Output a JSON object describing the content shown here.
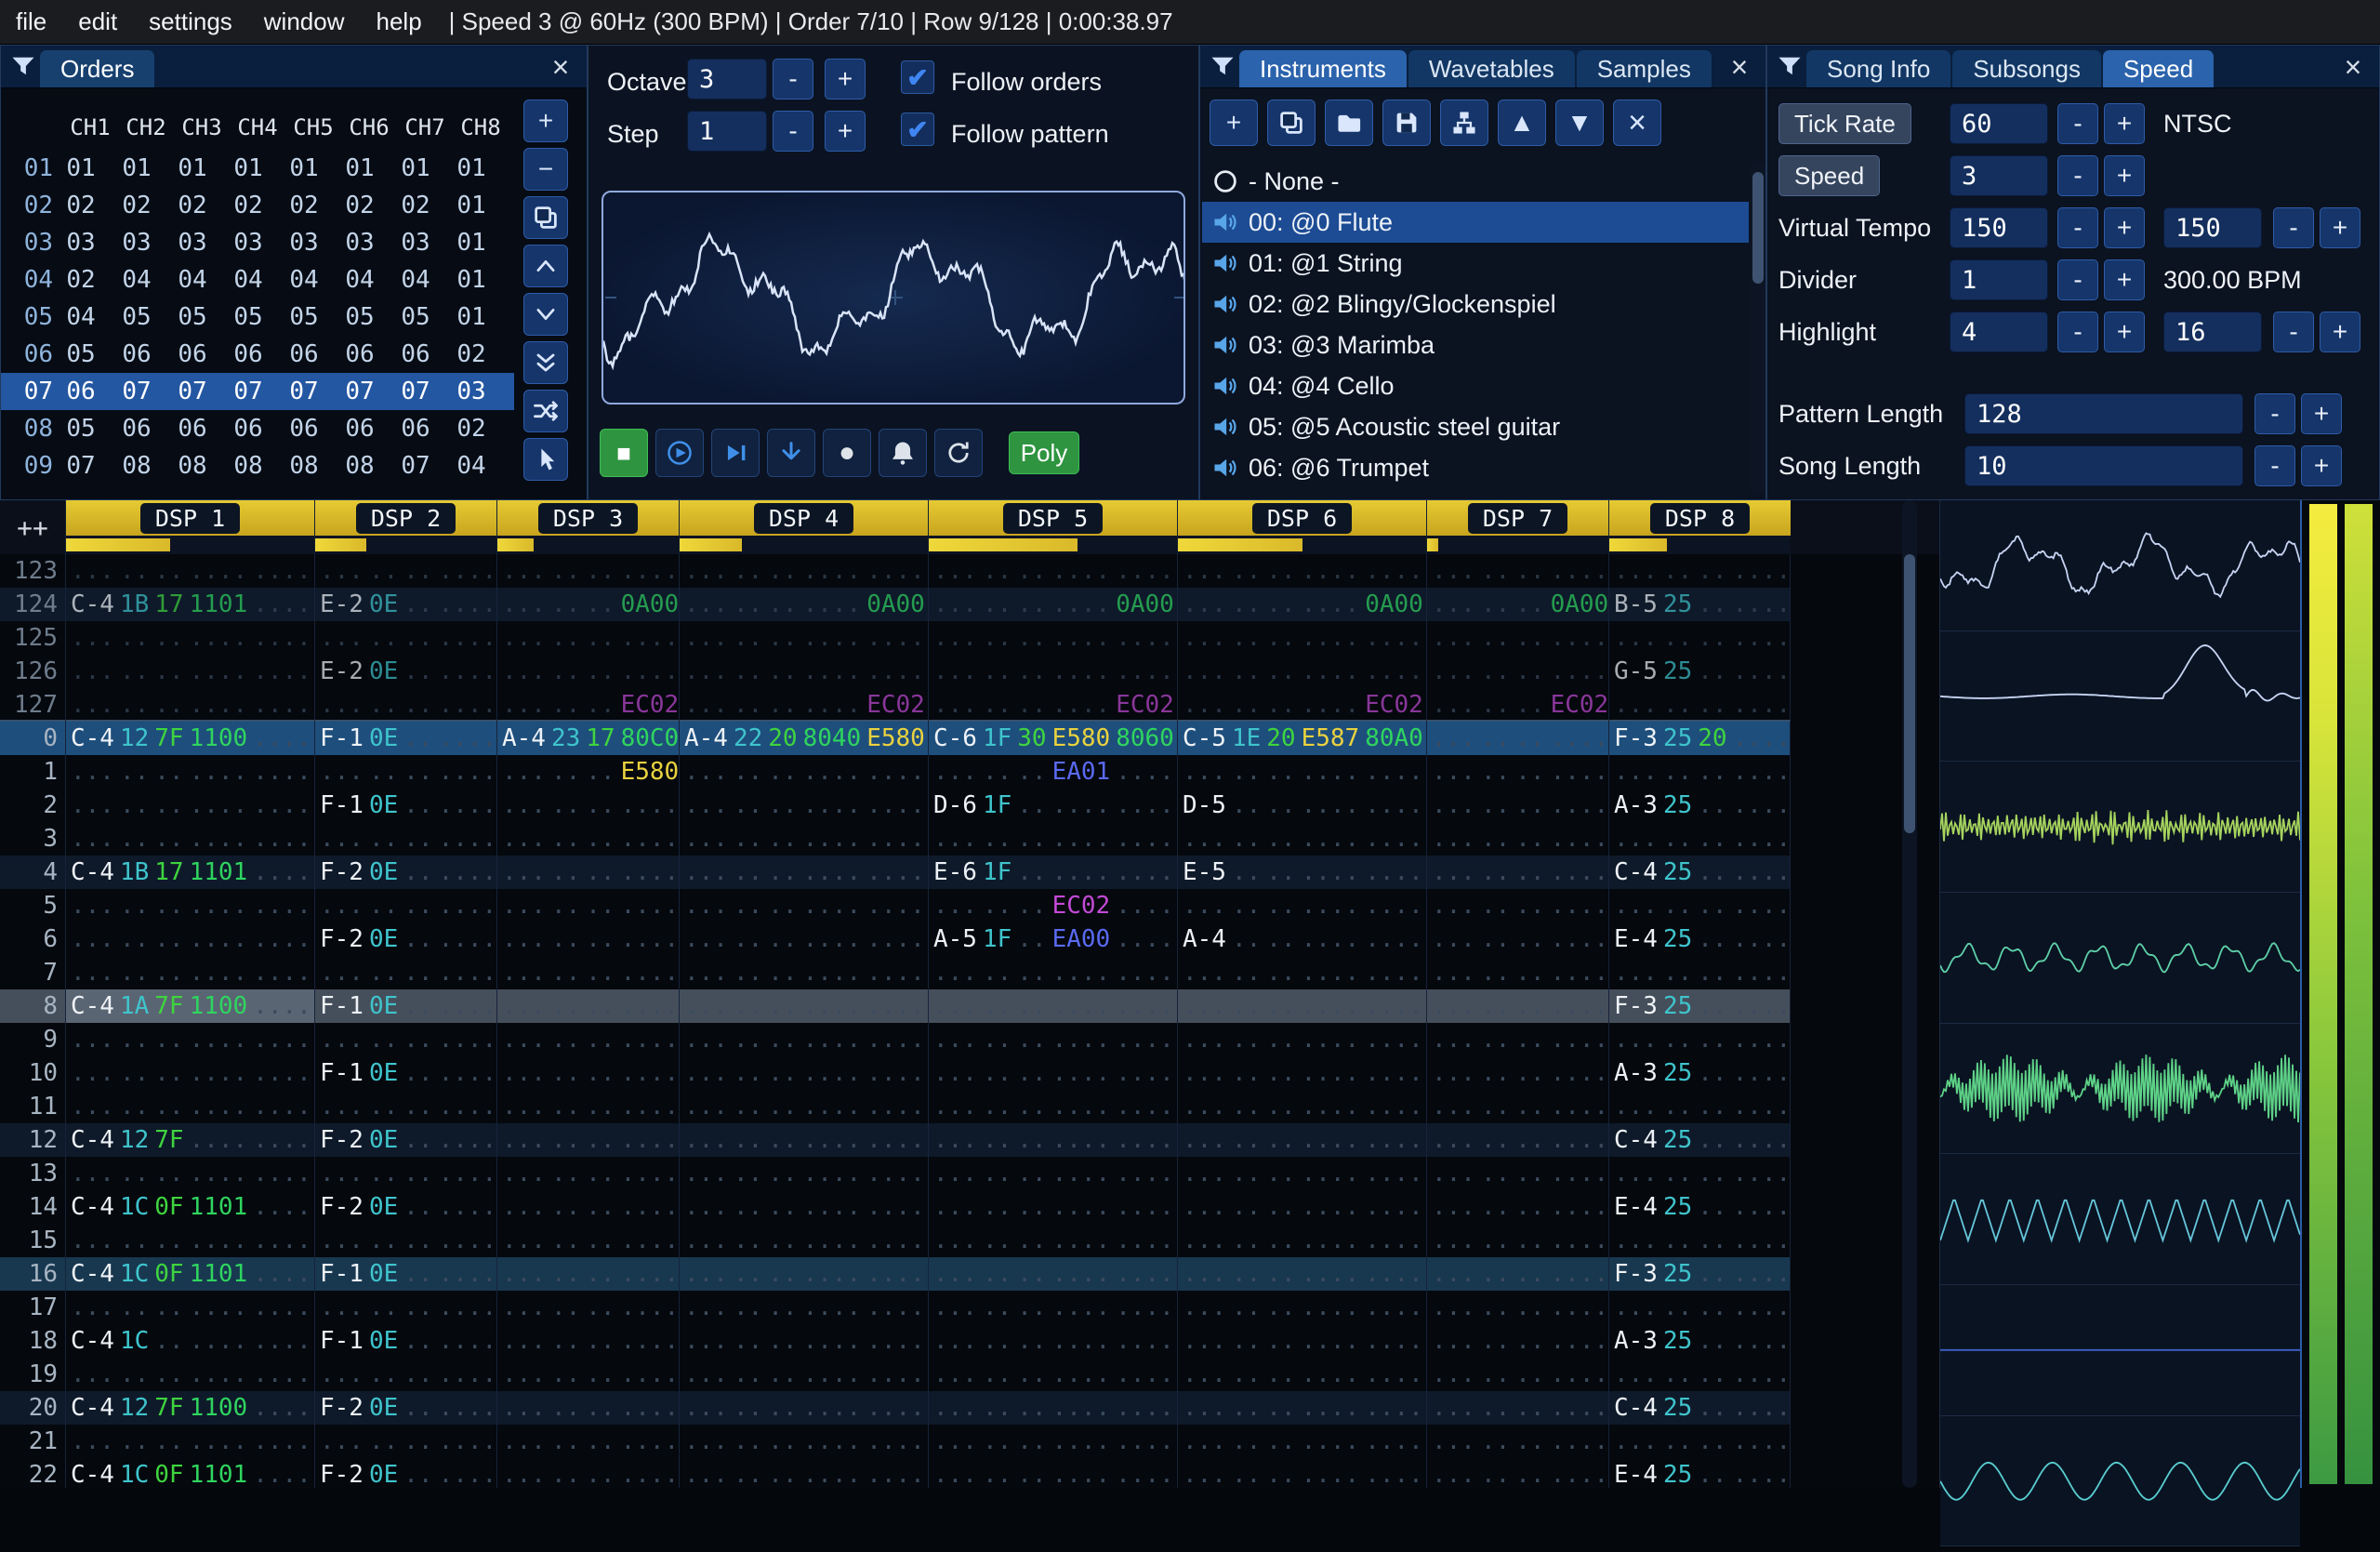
{
  "menu": {
    "items": [
      "file",
      "edit",
      "settings",
      "window",
      "help"
    ],
    "status": "| Speed 3 @ 60Hz (300 BPM) | Order 7/10 | Row 9/128 | 0:00:38.97"
  },
  "orders": {
    "title": "Orders",
    "close_label": "×",
    "columns": [
      "CH1",
      "CH2",
      "CH3",
      "CH4",
      "CH5",
      "CH6",
      "CH7",
      "CH8"
    ],
    "rows": [
      {
        "n": "01",
        "v": [
          "01",
          "01",
          "01",
          "01",
          "01",
          "01",
          "01",
          "01"
        ],
        "selected": false
      },
      {
        "n": "02",
        "v": [
          "02",
          "02",
          "02",
          "02",
          "02",
          "02",
          "02",
          "01"
        ],
        "selected": false
      },
      {
        "n": "03",
        "v": [
          "03",
          "03",
          "03",
          "03",
          "03",
          "03",
          "03",
          "01"
        ],
        "selected": false
      },
      {
        "n": "04",
        "v": [
          "02",
          "04",
          "04",
          "04",
          "04",
          "04",
          "04",
          "01"
        ],
        "selected": false
      },
      {
        "n": "05",
        "v": [
          "04",
          "05",
          "05",
          "05",
          "05",
          "05",
          "05",
          "01"
        ],
        "selected": false
      },
      {
        "n": "06",
        "v": [
          "05",
          "06",
          "06",
          "06",
          "06",
          "06",
          "06",
          "02"
        ],
        "selected": false
      },
      {
        "n": "07",
        "v": [
          "06",
          "07",
          "07",
          "07",
          "07",
          "07",
          "07",
          "03"
        ],
        "selected": true
      },
      {
        "n": "08",
        "v": [
          "05",
          "06",
          "06",
          "06",
          "06",
          "06",
          "06",
          "02"
        ],
        "selected": false
      },
      {
        "n": "09",
        "v": [
          "07",
          "08",
          "08",
          "08",
          "08",
          "08",
          "07",
          "04"
        ],
        "selected": false
      }
    ],
    "buttons": [
      {
        "icon": "plus",
        "name": "order-add-button"
      },
      {
        "icon": "minus",
        "name": "order-remove-button"
      },
      {
        "icon": "clone",
        "name": "order-duplicate-button"
      },
      {
        "icon": "chevron-up",
        "name": "order-move-up-button"
      },
      {
        "icon": "chevron-down",
        "name": "order-move-down-button"
      },
      {
        "icon": "chevron-double-down",
        "name": "order-duplicate-to-end-button"
      },
      {
        "icon": "shuffle",
        "name": "order-change-mode-button"
      },
      {
        "icon": "pointer",
        "name": "order-edit-mode-button"
      }
    ]
  },
  "controls": {
    "octave_label": "Octave",
    "octave_value": "3",
    "step_label": "Step",
    "step_value": "1",
    "minus_label": "-",
    "plus_label": "+",
    "follow_orders_label": "Follow orders",
    "follow_orders_checked": true,
    "follow_pattern_label": "Follow pattern",
    "follow_pattern_checked": true,
    "transport": [
      {
        "icon": "stop",
        "name": "stop-button",
        "style": "green"
      },
      {
        "icon": "play",
        "name": "play-button"
      },
      {
        "icon": "play-pattern",
        "name": "play-from-pattern-button"
      },
      {
        "icon": "step-down",
        "name": "step-one-row-button"
      },
      {
        "icon": "record",
        "name": "record-button"
      },
      {
        "icon": "bell",
        "name": "metronome-button"
      },
      {
        "icon": "repeat",
        "name": "repeat-pattern-button"
      }
    ],
    "poly_label": "Poly"
  },
  "instruments": {
    "tabs": [
      {
        "label": "Instruments",
        "active": true
      },
      {
        "label": "Wavetables",
        "active": false
      },
      {
        "label": "Samples",
        "active": false
      }
    ],
    "close_label": "×",
    "toolbar": [
      {
        "icon": "plus",
        "name": "instrument-add-button"
      },
      {
        "icon": "clone",
        "name": "instrument-clone-button"
      },
      {
        "icon": "folder-open",
        "name": "instrument-open-button"
      },
      {
        "icon": "floppy",
        "name": "instrument-save-button"
      },
      {
        "icon": "dir-tree",
        "name": "instrument-folders-button"
      },
      {
        "icon": "triangle-up",
        "name": "instrument-move-up-button"
      },
      {
        "icon": "triangle-down",
        "name": "instrument-move-down-button"
      },
      {
        "icon": "delete-x",
        "name": "instrument-delete-button"
      }
    ],
    "items": [
      {
        "icon": "none-circle",
        "label": "- None -",
        "selected": false
      },
      {
        "icon": "speaker",
        "label": "00: @0 Flute",
        "selected": true
      },
      {
        "icon": "speaker",
        "label": "01: @1 String",
        "selected": false
      },
      {
        "icon": "speaker",
        "label": "02: @2 Blingy/Glockenspiel",
        "selected": false
      },
      {
        "icon": "speaker",
        "label": "03: @3 Marimba",
        "selected": false
      },
      {
        "icon": "speaker",
        "label": "04: @4 Cello",
        "selected": false
      },
      {
        "icon": "speaker",
        "label": "05: @5 Acoustic steel guitar",
        "selected": false
      },
      {
        "icon": "speaker",
        "label": "06: @6 Trumpet",
        "selected": false
      }
    ]
  },
  "song": {
    "tabs": [
      {
        "label": "Song Info",
        "active": false
      },
      {
        "label": "Subsongs",
        "active": false
      },
      {
        "label": "Speed",
        "active": true
      }
    ],
    "close_label": "×",
    "tick_rate_label": "Tick Rate",
    "tick_rate_value": "60",
    "tick_rate_mode": "NTSC",
    "speed_label": "Speed",
    "speed_value": "3",
    "virtual_tempo_label": "Virtual Tempo",
    "virtual_tempo_value": "150",
    "virtual_tempo_divisor": "150",
    "divider_label": "Divider",
    "divider_value": "1",
    "bpm_text": "300.00 BPM",
    "highlight_label": "Highlight",
    "highlight_first": "4",
    "highlight_second": "16",
    "pattern_length_label": "Pattern Length",
    "pattern_length_value": "128",
    "song_length_label": "Song Length",
    "song_length_value": "10",
    "minus_label": "-",
    "plus_label": "+"
  },
  "pattern": {
    "corner_label": "++",
    "channels": [
      {
        "name": "DSP 1",
        "fx": 2,
        "vu": 0.42
      },
      {
        "name": "DSP 2",
        "fx": 1,
        "vu": 0.28
      },
      {
        "name": "DSP 3",
        "fx": 1,
        "vu": 0.2
      },
      {
        "name": "DSP 4",
        "fx": 2,
        "vu": 0.25
      },
      {
        "name": "DSP 5",
        "fx": 2,
        "vu": 0.6
      },
      {
        "name": "DSP 6",
        "fx": 2,
        "vu": 0.5
      },
      {
        "name": "DSP 7",
        "fx": 1,
        "vu": 0.06
      },
      {
        "name": "DSP 8",
        "fx": 1,
        "vu": 0.32
      }
    ],
    "rows": [
      {
        "n": "123",
        "prev": true,
        "cells": [
          "",
          "",
          "",
          "",
          "",
          "",
          "",
          ""
        ]
      },
      {
        "n": "124",
        "prev": true,
        "hl": "hl4",
        "cells": [
          "C-4 1B 17 1101 ....",
          "E-2 0E .. ....",
          "... .. .. 0A00",
          "... .. .. .... 0A00",
          "... .. .. .... 0A00",
          "... .. .. .... 0A00",
          "... .. .. 0A00",
          "B-5 25 .. ...."
        ]
      },
      {
        "n": "125",
        "prev": true,
        "cells": [
          "",
          "",
          "",
          "",
          "",
          "",
          "",
          ""
        ]
      },
      {
        "n": "126",
        "prev": true,
        "cells": [
          "",
          "E-2 0E .. ....",
          "",
          "",
          "",
          "",
          "",
          "G-5 25 .. ...."
        ]
      },
      {
        "n": "127",
        "prev": true,
        "boundary": true,
        "cells": [
          "",
          "",
          "... .. .. EC02",
          "... .. .. .... EC02",
          "... .. .. .... EC02",
          "... .. .. .... EC02",
          "... .. .. EC02",
          ""
        ]
      },
      {
        "n": "0",
        "hl": "play",
        "cells": [
          "C-4 12 7F 1100 ....",
          "F-1 0E .. ....",
          "A-4 23 17 80C0",
          "A-4 22 20 8040 E580",
          "C-6 1F 30 E580 8060",
          "C-5 1E 20 E587 80A0",
          "",
          "F-3 25 20 ...."
        ]
      },
      {
        "n": "1",
        "cells": [
          "",
          "",
          "... .. .. E580",
          "",
          "... .. .. EA01 ....",
          "",
          "",
          ""
        ]
      },
      {
        "n": "2",
        "cells": [
          "",
          "F-1 0E .. ....",
          "",
          "",
          "D-6 1F .. .... ....",
          "D-5 .. .. .... ....",
          "",
          "A-3 25 .. ...."
        ]
      },
      {
        "n": "3",
        "cells": [
          "",
          "",
          "",
          "",
          "",
          "",
          "",
          ""
        ]
      },
      {
        "n": "4",
        "hl": "hl4",
        "cells": [
          "C-4 1B 17 1101 ....",
          "F-2 0E .. ....",
          "",
          "",
          "E-6 1F .. .... ....",
          "E-5 .. .. .... ....",
          "",
          "C-4 25 .. ...."
        ]
      },
      {
        "n": "5",
        "cells": [
          "",
          "",
          "",
          "",
          "... .. .. EC02 ....",
          "",
          "",
          ""
        ]
      },
      {
        "n": "6",
        "cells": [
          "",
          "F-2 0E .. ....",
          "",
          "",
          "A-5 1F .. EA00 ....",
          "A-4 .. .. .... ....",
          "",
          "E-4 25 .. ...."
        ]
      },
      {
        "n": "7",
        "cells": [
          "",
          "",
          "",
          "",
          "",
          "",
          "",
          ""
        ]
      },
      {
        "n": "8",
        "hl": "cursor",
        "cells": [
          "C-4 1A 7F 1100 ....",
          "F-1 0E .. ....",
          "",
          "",
          "",
          "",
          "",
          "F-3 25 .. ...."
        ]
      },
      {
        "n": "9",
        "cells": [
          "",
          "",
          "",
          "",
          "",
          "",
          "",
          ""
        ]
      },
      {
        "n": "10",
        "cells": [
          "",
          "F-1 0E .. ....",
          "",
          "",
          "",
          "",
          "",
          "A-3 25 .. ...."
        ]
      },
      {
        "n": "11",
        "cells": [
          "",
          "",
          "",
          "",
          "",
          "",
          "",
          ""
        ]
      },
      {
        "n": "12",
        "hl": "hl4",
        "cells": [
          "C-4 12 7F .... ....",
          "F-2 0E .. ....",
          "",
          "",
          "",
          "",
          "",
          "C-4 25 .. ...."
        ]
      },
      {
        "n": "13",
        "cells": [
          "",
          "",
          "",
          "",
          "",
          "",
          "",
          ""
        ]
      },
      {
        "n": "14",
        "cells": [
          "C-4 1C 0F 1101 ....",
          "F-2 0E .. ....",
          "",
          "",
          "",
          "",
          "",
          "E-4 25 .. ...."
        ]
      },
      {
        "n": "15",
        "cells": [
          "",
          "",
          "",
          "",
          "",
          "",
          "",
          ""
        ]
      },
      {
        "n": "16",
        "hl": "hl16",
        "cells": [
          "C-4 1C 0F 1101 ....",
          "F-1 0E .. ....",
          "",
          "",
          "",
          "",
          "",
          "F-3 25 .. ...."
        ]
      },
      {
        "n": "17",
        "cells": [
          "",
          "",
          "",
          "",
          "",
          "",
          "",
          ""
        ]
      },
      {
        "n": "18",
        "cells": [
          "C-4 1C .. .... ....",
          "F-1 0E .. ....",
          "",
          "",
          "",
          "",
          "",
          "A-3 25 .. ...."
        ]
      },
      {
        "n": "19",
        "cells": [
          "",
          "",
          "",
          "",
          "",
          "",
          "",
          ""
        ]
      },
      {
        "n": "20",
        "hl": "hl4",
        "cells": [
          "C-4 12 7F 1100 ....",
          "F-2 0E .. ....",
          "",
          "",
          "",
          "",
          "",
          "C-4 25 .. ...."
        ]
      },
      {
        "n": "21",
        "cells": [
          "",
          "",
          "",
          "",
          "",
          "",
          "",
          ""
        ]
      },
      {
        "n": "22",
        "cells": [
          "C-4 1C 0F 1101 ....",
          "F-2 0E .. ....",
          "",
          "",
          "",
          "",
          "",
          "E-4 25 .. ...."
        ]
      }
    ]
  },
  "scopes": [
    {
      "channel": "DSP 1",
      "wave": "complex",
      "color": "#c6d4f2"
    },
    {
      "channel": "DSP 2",
      "wave": "hump",
      "color": "#c6d4f2"
    },
    {
      "channel": "DSP 3",
      "wave": "noise-dense",
      "color": "#a6d45e"
    },
    {
      "channel": "DSP 4",
      "wave": "sine-small",
      "color": "#5ecfa8"
    },
    {
      "channel": "DSP 5",
      "wave": "dense-big",
      "color": "#5ed287"
    },
    {
      "channel": "DSP 6",
      "wave": "zigzag",
      "color": "#66c6da"
    },
    {
      "channel": "DSP 7",
      "wave": "flat",
      "color": "#3f62c8"
    },
    {
      "channel": "DSP 8",
      "wave": "sine",
      "color": "#58cdd0"
    }
  ],
  "colors": {
    "accent": "#2b63ac",
    "header_yellow": "#e6cb33",
    "note": "#eef2f6",
    "instrument": "#3fc4cc",
    "volume": "#3fd43f",
    "fx_green": "#2fd45f",
    "fx_yellow": "#ead23f",
    "fx_purple": "#c24ad6",
    "fx_blue": "#5a6af2"
  }
}
